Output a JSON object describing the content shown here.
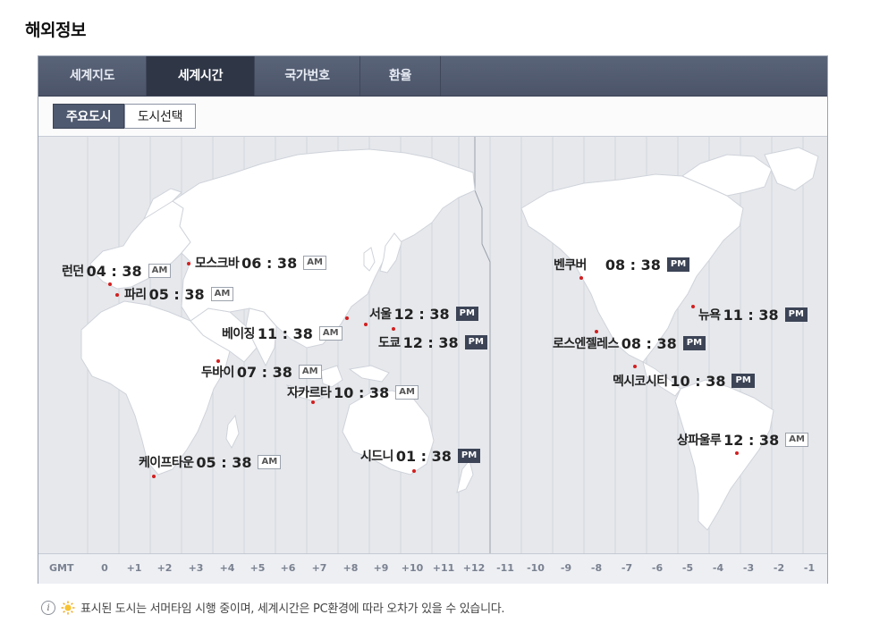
{
  "page": {
    "title": "해외정보"
  },
  "tabs": [
    {
      "label": "세계지도",
      "active": false
    },
    {
      "label": "세계시간",
      "active": true
    },
    {
      "label": "국가번호",
      "active": false
    },
    {
      "label": "환율",
      "active": false
    }
  ],
  "subtabs": [
    {
      "label": "주요도시",
      "active": true
    },
    {
      "label": "도시선택",
      "active": false
    }
  ],
  "cities": [
    {
      "name": "런던",
      "time": "04 : 38",
      "ampm": "AM"
    },
    {
      "name": "파리",
      "time": "05 : 38",
      "ampm": "AM"
    },
    {
      "name": "모스크바",
      "time": "06 : 38",
      "ampm": "AM"
    },
    {
      "name": "베이징",
      "time": "11 : 38",
      "ampm": "AM"
    },
    {
      "name": "서울",
      "time": "12 : 38",
      "ampm": "PM"
    },
    {
      "name": "도쿄",
      "time": "12 : 38",
      "ampm": "PM"
    },
    {
      "name": "두바이",
      "time": "07 : 38",
      "ampm": "AM"
    },
    {
      "name": "자카르타",
      "time": "10 : 38",
      "ampm": "AM"
    },
    {
      "name": "케이프타운",
      "time": "05 : 38",
      "ampm": "AM"
    },
    {
      "name": "시드니",
      "time": "01 : 38",
      "ampm": "PM"
    },
    {
      "name": "벤쿠버",
      "time": "08 : 38",
      "ampm": "PM"
    },
    {
      "name": "뉴욕",
      "time": "11 : 38",
      "ampm": "PM"
    },
    {
      "name": "로스엔젤레스",
      "time": "08 : 38",
      "ampm": "PM"
    },
    {
      "name": "멕시코시티",
      "time": "10 : 38",
      "ampm": "PM"
    },
    {
      "name": "상파울루",
      "time": "12 : 38",
      "ampm": "AM"
    }
  ],
  "gmt": {
    "label": "GMT",
    "offsets": [
      "0",
      "+1",
      "+2",
      "+3",
      "+4",
      "+5",
      "+6",
      "+7",
      "+8",
      "+9",
      "+10",
      "+11",
      "+12",
      "-11",
      "-10",
      "-9",
      "-8",
      "-7",
      "-6",
      "-5",
      "-4",
      "-3",
      "-2",
      "-1"
    ]
  },
  "footnote": {
    "text": "표시된 도시는 서머타임 시행 중이며, 세계시간은 PC환경에 따라 오차가 있을 수 있습니다."
  },
  "colors": {
    "tab_bg": "#4f586c",
    "active_tab_bg": "#2f3646",
    "pm_badge": "#3c4456",
    "city_dot": "#d21f1f",
    "map_bg": "#e6e8ec",
    "land": "#ffffff"
  },
  "icons": {
    "info": "info-icon",
    "sun": "sun-icon"
  }
}
